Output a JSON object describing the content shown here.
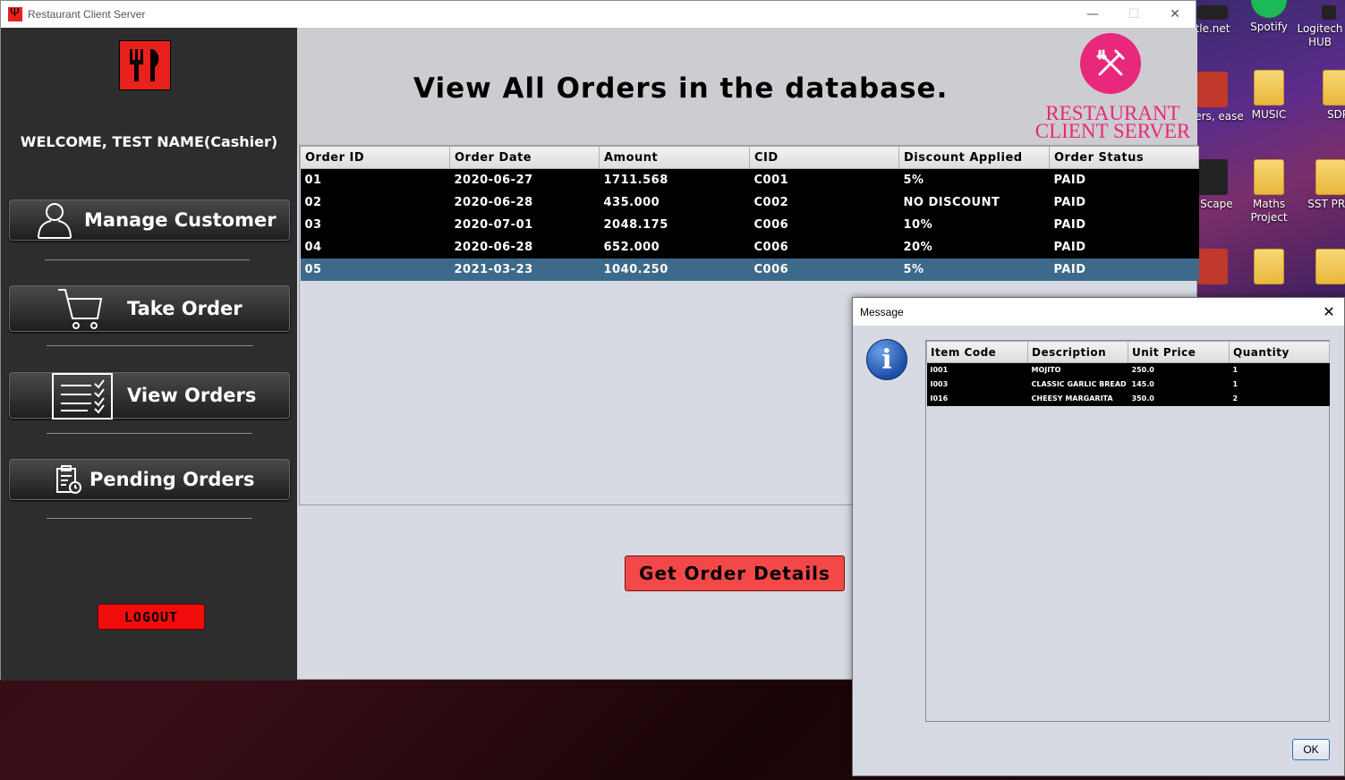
{
  "window": {
    "title": "Restaurant Client Server",
    "minimize": "—",
    "maximize": "☐",
    "close": "✕"
  },
  "desktop": {
    "icons": [
      {
        "label": "tle.net"
      },
      {
        "label": "Spotify"
      },
      {
        "label": "Logitech HUB"
      },
      {
        "label": "apers, ease"
      },
      {
        "label": "MUSIC"
      },
      {
        "label": "SDP"
      },
      {
        "label": "r Scape"
      },
      {
        "label": "Maths Project"
      },
      {
        "label": "SST PRO"
      }
    ]
  },
  "sidebar": {
    "welcome": "WELCOME, TEST NAME(Cashier)",
    "nav": [
      {
        "label": "Manage Customer",
        "icon": "person-icon"
      },
      {
        "label": "Take Order",
        "icon": "cart-icon"
      },
      {
        "label": "View Orders",
        "icon": "checklist-icon"
      },
      {
        "label": "Pending Orders",
        "icon": "clipboard-clock-icon"
      }
    ],
    "logout": "LOGOUT"
  },
  "header": {
    "title": "View All Orders in the database.",
    "brand_line1": "RESTAURANT",
    "brand_line2": "CLIENT SERVER",
    "brand_color": "#e8287a"
  },
  "orders": {
    "columns": [
      "Order ID",
      "Order Date",
      "Amount",
      "CID",
      "Discount Applied",
      "Order Status"
    ],
    "rows": [
      [
        "01",
        "2020-06-27",
        "1711.568",
        "C001",
        "5%",
        "PAID"
      ],
      [
        "02",
        "2020-06-28",
        "435.000",
        "C002",
        "NO DISCOUNT",
        "PAID"
      ],
      [
        "03",
        "2020-07-01",
        "2048.175",
        "C006",
        "10%",
        "PAID"
      ],
      [
        "04",
        "2020-06-28",
        "652.000",
        "C006",
        "20%",
        "PAID"
      ],
      [
        "05",
        "2021-03-23",
        "1040.250",
        "C006",
        "5%",
        "PAID"
      ]
    ],
    "selected_row": 4
  },
  "actions": {
    "get_details": "Get Order Details"
  },
  "dialog": {
    "title": "Message",
    "close": "✕",
    "info_glyph": "i",
    "columns": [
      "Item Code",
      "Description",
      "Unit Price",
      "Quantity"
    ],
    "rows": [
      [
        "I001",
        "MOJITO",
        "250.0",
        "1"
      ],
      [
        "I003",
        "CLASSIC GARLIC BREAD",
        "145.0",
        "1"
      ],
      [
        "I016",
        "CHEESY MARGARITA",
        "350.0",
        "2"
      ]
    ],
    "ok": "OK"
  }
}
